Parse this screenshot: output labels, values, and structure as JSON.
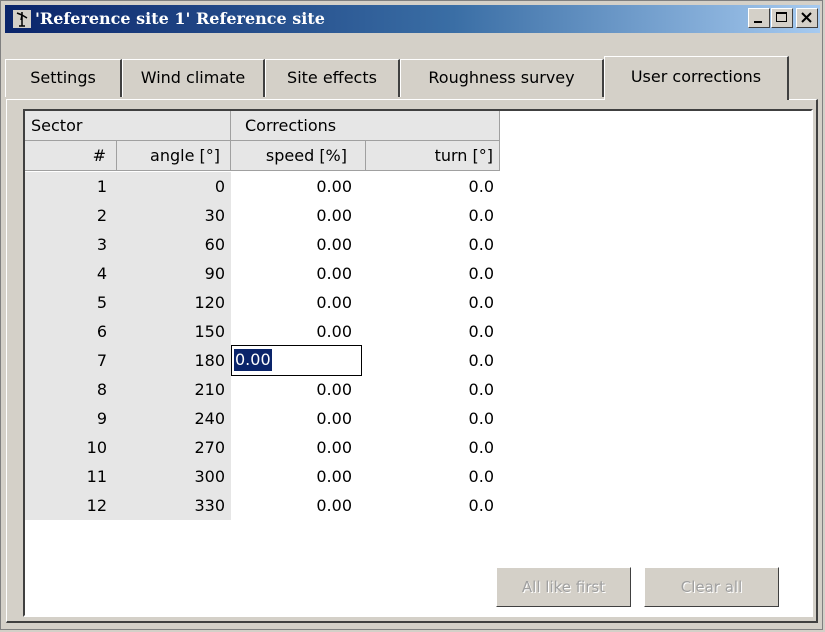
{
  "window": {
    "title": "'Reference site 1' Reference site",
    "minimize_label": "_",
    "colors": {
      "title_start": "#0a246a",
      "title_end": "#a6caf0",
      "selection": "#0a246a"
    }
  },
  "tabs": [
    {
      "label": "Settings",
      "active": false
    },
    {
      "label": "Wind climate",
      "active": false
    },
    {
      "label": "Site effects",
      "active": false
    },
    {
      "label": "Roughness survey",
      "active": false
    },
    {
      "label": "User corrections",
      "active": true
    }
  ],
  "grid": {
    "group_headers": {
      "sector": "Sector",
      "corrections": "Corrections"
    },
    "columns": {
      "num": "#",
      "angle": "angle [°]",
      "speed": "speed [%]",
      "turn": "turn [°]"
    },
    "rows": [
      {
        "num": "1",
        "angle": "0",
        "speed": "0.00",
        "turn": "0.0"
      },
      {
        "num": "2",
        "angle": "30",
        "speed": "0.00",
        "turn": "0.0"
      },
      {
        "num": "3",
        "angle": "60",
        "speed": "0.00",
        "turn": "0.0"
      },
      {
        "num": "4",
        "angle": "90",
        "speed": "0.00",
        "turn": "0.0"
      },
      {
        "num": "5",
        "angle": "120",
        "speed": "0.00",
        "turn": "0.0"
      },
      {
        "num": "6",
        "angle": "150",
        "speed": "0.00",
        "turn": "0.0"
      },
      {
        "num": "7",
        "angle": "180",
        "speed": "0.00",
        "turn": "0.0"
      },
      {
        "num": "8",
        "angle": "210",
        "speed": "0.00",
        "turn": "0.0"
      },
      {
        "num": "9",
        "angle": "240",
        "speed": "0.00",
        "turn": "0.0"
      },
      {
        "num": "10",
        "angle": "270",
        "speed": "0.00",
        "turn": "0.0"
      },
      {
        "num": "11",
        "angle": "300",
        "speed": "0.00",
        "turn": "0.0"
      },
      {
        "num": "12",
        "angle": "330",
        "speed": "0.00",
        "turn": "0.0"
      }
    ],
    "editing_row": 7
  },
  "buttons": {
    "all_like_first": "All like first",
    "clear_all": "Clear all"
  }
}
